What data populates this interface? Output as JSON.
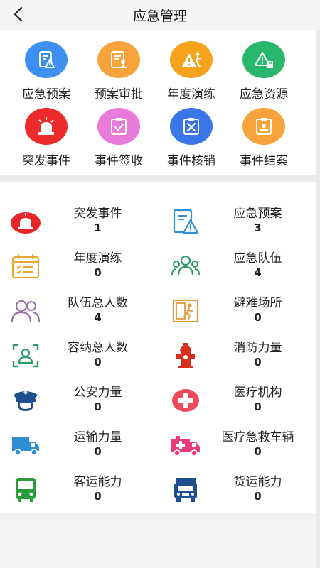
{
  "header": {
    "title": "应急管理"
  },
  "grid": [
    {
      "label": "应急预案",
      "color": "#3d8ff0",
      "icon": "document-warning-icon"
    },
    {
      "label": "预案审批",
      "color": "#f5a33a",
      "icon": "document-approval-icon"
    },
    {
      "label": "年度演练",
      "color": "#f7a21d",
      "icon": "drill-icon"
    },
    {
      "label": "应急资源",
      "color": "#29b86b",
      "icon": "resource-warning-icon"
    },
    {
      "label": "突发事件",
      "color": "#ee2b2b",
      "icon": "alarm-light-icon"
    },
    {
      "label": "事件签收",
      "color": "#e87bd9",
      "icon": "sign-receive-icon"
    },
    {
      "label": "事件核销",
      "color": "#3a76e8",
      "icon": "cancel-clipboard-icon"
    },
    {
      "label": "事件结案",
      "color": "#f5a33a",
      "icon": "case-close-icon"
    }
  ],
  "stats": [
    {
      "label": "突发事件",
      "value": "1",
      "icon": "alarm-light-icon"
    },
    {
      "label": "应急预案",
      "value": "3",
      "icon": "document-warning-icon"
    },
    {
      "label": "年度演练",
      "value": "0",
      "icon": "calendar-list-icon"
    },
    {
      "label": "应急队伍",
      "value": "4",
      "icon": "team-icon"
    },
    {
      "label": "队伍总人数",
      "value": "4",
      "icon": "people-icon"
    },
    {
      "label": "避难场所",
      "value": "0",
      "icon": "emergency-exit-icon"
    },
    {
      "label": "容纳总人数",
      "value": "0",
      "icon": "id-card-icon"
    },
    {
      "label": "消防力量",
      "value": "0",
      "icon": "fire-hydrant-icon"
    },
    {
      "label": "公安力量",
      "value": "0",
      "icon": "police-cap-icon"
    },
    {
      "label": "医疗机构",
      "value": "0",
      "icon": "medical-cross-icon"
    },
    {
      "label": "运输力量",
      "value": "0",
      "icon": "truck-icon"
    },
    {
      "label": "医疗急救车辆",
      "value": "0",
      "icon": "ambulance-icon"
    },
    {
      "label": "客运能力",
      "value": "0",
      "icon": "bus-icon"
    },
    {
      "label": "货运能力",
      "value": "0",
      "icon": "cargo-truck-icon"
    }
  ]
}
